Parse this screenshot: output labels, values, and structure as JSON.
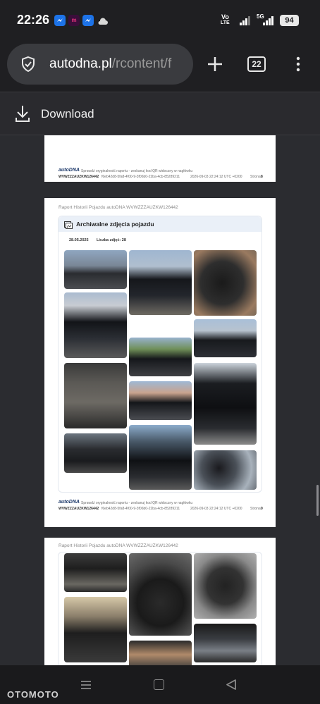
{
  "status": {
    "time": "22:26",
    "net1": "Vo",
    "net1sub": "LTE",
    "net2": "5G",
    "battery": "94"
  },
  "browser": {
    "url_domain": "autodna.pl",
    "url_path": "/rcontent/f",
    "tab_count": "22"
  },
  "download": {
    "label": "Download"
  },
  "report": {
    "brand": "autoDNA",
    "note": "Sprawdź oryginalność raportu - zeskanuj kod QR widoczny w nagłówku",
    "vin_id": "WVWZZZAUZKW126442",
    "hash": "f6eb42d8-5fa8-4f00-9-3f06b0-22ba-4cb-85289211",
    "generated": "2026-09-03 22:24:12 UTC +0200",
    "page_prefix": "Strona",
    "header": "Raport Historii Pojazdu autoDNA WVWZZZAUZKW126442",
    "section_title": "Archiwalne zdjęcia pojazdu",
    "date": "28.05.2025",
    "count_label": "Liczba zdjęć: 28",
    "pages": [
      {
        "num": "8"
      },
      {
        "num": "9"
      }
    ]
  },
  "watermark": "OTOMOTO",
  "icons": {
    "shield": "shield-check-icon",
    "plus": "plus-icon",
    "tabs": "tab-switcher-icon",
    "menu": "overflow-menu-icon",
    "download": "download-icon",
    "photos": "photo-gallery-icon"
  }
}
